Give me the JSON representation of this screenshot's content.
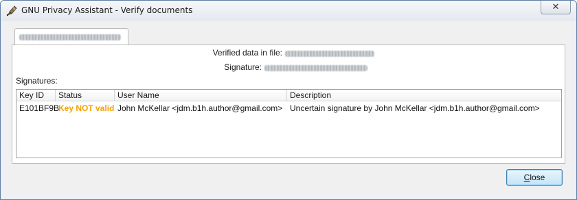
{
  "window": {
    "title": "GNU Privacy Assistant - Verify documents",
    "close_glyph": "✕",
    "app_icon": "gpa-pen-icon"
  },
  "tab": {
    "label_redacted": true
  },
  "info": {
    "verified_label": "Verified data in file:",
    "signature_label": "Signature:"
  },
  "signatures": {
    "label": "Signatures:",
    "columns": [
      "Key ID",
      "Status",
      "User Name",
      "Description"
    ],
    "rows": [
      {
        "key_id": "E101BF9B",
        "status": "Key NOT valid",
        "user_name": "John McKellar <jdm.b1h.author@gmail.com>",
        "description": "Uncertain signature by John McKellar <jdm.b1h.author@gmail.com>"
      }
    ]
  },
  "buttons": {
    "close_first": "C",
    "close_rest": "lose"
  },
  "colors": {
    "status_warning": "#f5a300",
    "button_border": "#3c7fb1"
  }
}
